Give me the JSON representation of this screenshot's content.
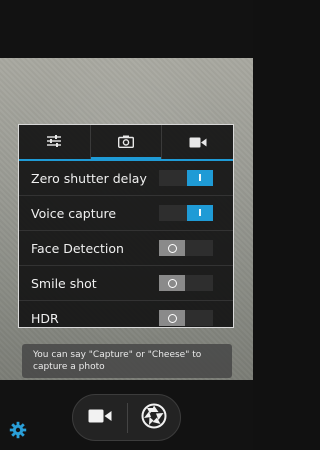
{
  "settings": {
    "tabs": [
      {
        "icon": "sliders-icon",
        "active": false
      },
      {
        "icon": "camera-icon",
        "active": true
      },
      {
        "icon": "video-camera-icon",
        "active": false
      }
    ],
    "rows": [
      {
        "label": "Zero shutter delay",
        "state": "on",
        "toggle_text": "I"
      },
      {
        "label": "Voice capture",
        "state": "on",
        "toggle_text": "I"
      },
      {
        "label": "Face Detection",
        "state": "off"
      },
      {
        "label": "Smile shot",
        "state": "off"
      },
      {
        "label": "HDR",
        "state": "off"
      }
    ]
  },
  "hint": {
    "text": "You can say \"Capture\" or \"Cheese\" to capture a photo"
  },
  "controls": {
    "video_icon": "video-camera-icon",
    "shutter_icon": "shutter-aperture-icon",
    "settings_icon": "gear-icon"
  },
  "colors": {
    "accent": "#1f9bd6",
    "toggle_off": "#8a8a8a",
    "panel_bg": "#141414"
  }
}
